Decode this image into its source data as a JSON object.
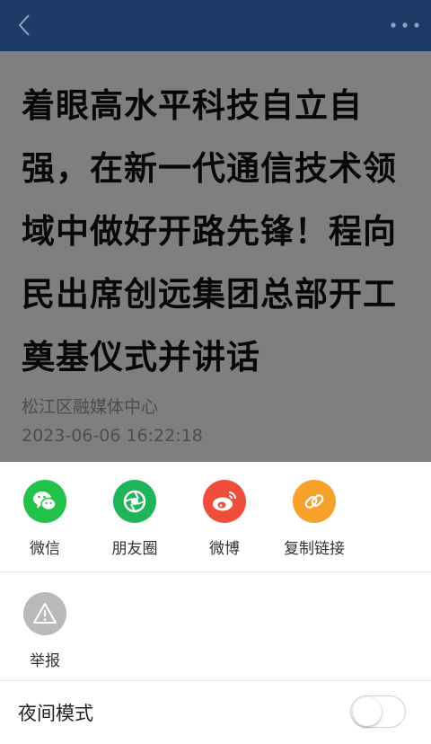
{
  "article": {
    "title": "着眼高水平科技自立自强，在新一代通信技术领域中做好开路先锋！程向民出席创远集团总部开工奠基仪式并讲话",
    "source": "松江区融媒体中心",
    "date": "2023-06-06 16:22:18"
  },
  "header": {
    "back_icon": "back-chevron-icon",
    "more_icon": "more-dots-icon",
    "color": "#1e3a66"
  },
  "share_sheet": {
    "items": [
      {
        "label": "微信",
        "icon": "wechat-icon",
        "color": "#23c24a"
      },
      {
        "label": "朋友圈",
        "icon": "moments-icon",
        "color": "#1fb45a"
      },
      {
        "label": "微博",
        "icon": "weibo-icon",
        "color": "#ef4f3a"
      },
      {
        "label": "复制链接",
        "icon": "link-icon",
        "color": "#f5a12a"
      }
    ],
    "report": {
      "label": "举报",
      "icon": "warning-icon",
      "color": "#b9b9b9"
    },
    "night_mode": {
      "label": "夜间模式",
      "enabled": false
    }
  }
}
